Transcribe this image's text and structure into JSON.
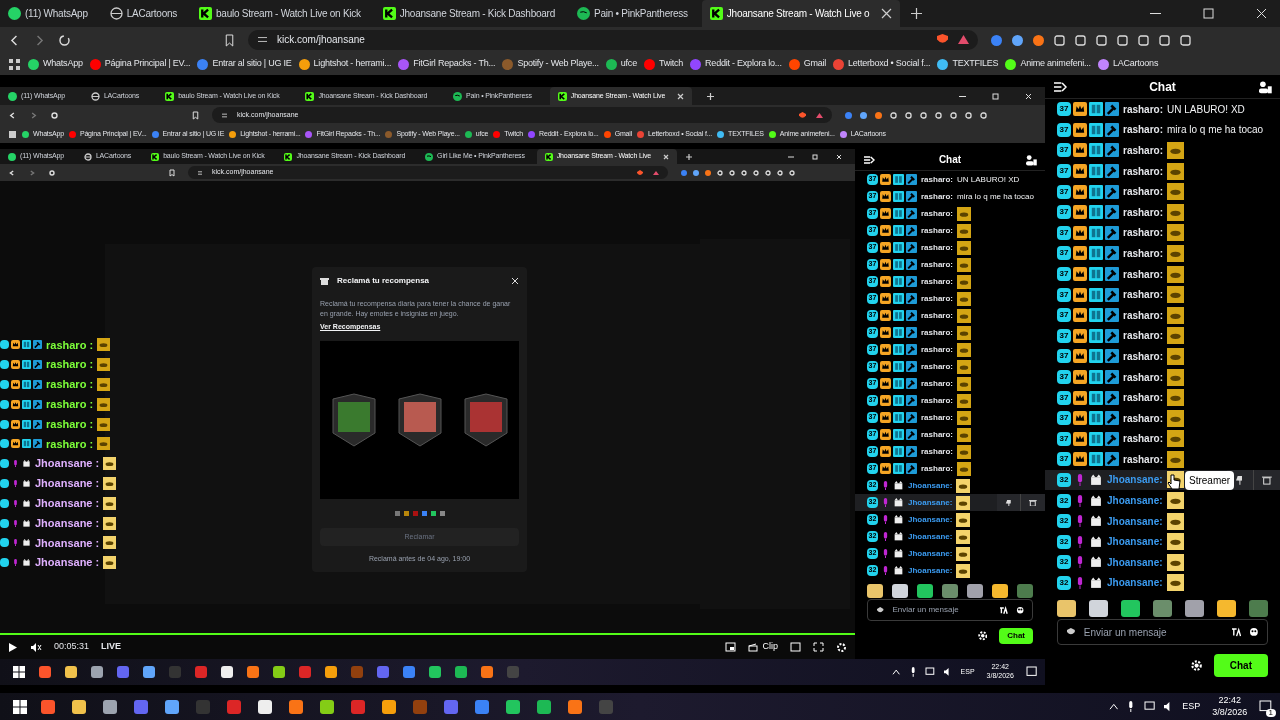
{
  "browser": {
    "tabs": [
      {
        "title": "(11) WhatsApp",
        "kind": "whatsapp",
        "selected": false
      },
      {
        "title": "LACartoons",
        "kind": "globe",
        "selected": false
      },
      {
        "title": "baulo Stream - Watch Live on Kick",
        "kind": "kick",
        "selected": false
      },
      {
        "title": "Jhoansane Stream - Kick Dashboard",
        "kind": "kick",
        "selected": false
      },
      {
        "title": "Pain • PinkPantheress",
        "kind": "spotify",
        "selected": false
      },
      {
        "title": "Jhoansane Stream - Watch Live o",
        "kind": "kick",
        "selected": true
      }
    ],
    "address": "kick.com/jhoansane",
    "bookmarks": [
      "WhatsApp",
      "Página Principal | EV...",
      "Entrar al sitio | UG IE",
      "Lightshot - herrami...",
      "FitGirl Repacks - Th...",
      "Spotify - Web Playe...",
      "ufce",
      "Twitch",
      "Reddit - Explora lo...",
      "Gmail",
      "Letterboxd • Social f...",
      "TEXTFILES",
      "Anime animefeni...",
      "LACartoons"
    ]
  },
  "stream": {
    "browser": {
      "tabs": [
        {
          "title": "(11) WhatsApp",
          "kind": "whatsapp",
          "selected": false
        },
        {
          "title": "LACartoons",
          "kind": "globe",
          "selected": false
        },
        {
          "title": "baulo Stream - Watch Live on Kick",
          "kind": "kick",
          "selected": false
        },
        {
          "title": "Jhoansane Stream - Kick Dashboard",
          "kind": "kick",
          "selected": false
        },
        {
          "title": "Pain • PinkPantheress",
          "kind": "spotify",
          "selected": false
        },
        {
          "title": "Jhoansane Stream - Watch Live",
          "kind": "kick",
          "selected": true
        }
      ],
      "address": "kick.com/jhoansane",
      "bookmarks": [
        "WhatsApp",
        "Página Principal | EV...",
        "Entrar al sitio | UG IE",
        "Lightshot - herrami...",
        "FitGirl Repacks - Th...",
        "Spotify - Web Playe...",
        "ufce",
        "Twitch",
        "Reddit - Explora lo...",
        "Gmail",
        "Letterboxd • Social f...",
        "TEXTFILES",
        "Anime animefeni...",
        "LACartoons"
      ]
    },
    "capture": {
      "tabs": [
        {
          "title": "(11) WhatsApp",
          "kind": "whatsapp",
          "selected": false
        },
        {
          "title": "LACartoons",
          "kind": "globe",
          "selected": false
        },
        {
          "title": "baulo Stream - Watch Live on Kick",
          "kind": "kick",
          "selected": false
        },
        {
          "title": "Jhoansane Stream - Kick Dashboard",
          "kind": "kick",
          "selected": false
        },
        {
          "title": "Girl Like Me • PinkPantheress",
          "kind": "spotify",
          "selected": false
        },
        {
          "title": "Jhoansane Stream - Watch Live",
          "kind": "kick",
          "selected": true
        }
      ],
      "address": "kick.com/jhoansane",
      "popup": {
        "title": "Reclamá tu recompensa",
        "body": "Reclamá tu recompensa diaria para tener la chance de ganar en grande. Hay emotes e insignias en juego.",
        "link": "Ver Recompensas",
        "button": "Reclamar",
        "deadline": "Reclamá antes de 04 ago, 19:00"
      },
      "overlay_chat": [
        {
          "user": "rasharo :",
          "kind": "viewer"
        },
        {
          "user": "rasharo :",
          "kind": "viewer"
        },
        {
          "user": "rasharo :",
          "kind": "viewer"
        },
        {
          "user": "rasharo :",
          "kind": "viewer"
        },
        {
          "user": "rasharo :",
          "kind": "viewer"
        },
        {
          "user": "rasharo :",
          "kind": "viewer"
        },
        {
          "user": "Jhoansane :",
          "kind": "broadcaster"
        },
        {
          "user": "Jhoansane :",
          "kind": "broadcaster"
        },
        {
          "user": "Jhoansane :",
          "kind": "broadcaster"
        },
        {
          "user": "Jhoansane :",
          "kind": "broadcaster"
        },
        {
          "user": "Jhoansane :",
          "kind": "broadcaster"
        },
        {
          "user": "Jhoansane :",
          "kind": "broadcaster"
        }
      ]
    },
    "chat": {
      "title": "Chat",
      "messages": [
        {
          "kind": "viewer",
          "level_badge": "37",
          "user": "rasharo:",
          "text": "UN LABURO! XD",
          "emote": false,
          "hovered": false
        },
        {
          "kind": "viewer",
          "level_badge": "37",
          "user": "rasharo:",
          "text": "mira lo q me ha tocao",
          "emote": false,
          "hovered": false
        },
        {
          "kind": "viewer",
          "level_badge": "37",
          "user": "rasharo:",
          "emote": true,
          "hovered": false
        },
        {
          "kind": "viewer",
          "level_badge": "37",
          "user": "rasharo:",
          "emote": true,
          "hovered": false
        },
        {
          "kind": "viewer",
          "level_badge": "37",
          "user": "rasharo:",
          "emote": true,
          "hovered": false
        },
        {
          "kind": "viewer",
          "level_badge": "37",
          "user": "rasharo:",
          "emote": true,
          "hovered": false
        },
        {
          "kind": "viewer",
          "level_badge": "37",
          "user": "rasharo:",
          "emote": true,
          "hovered": false
        },
        {
          "kind": "viewer",
          "level_badge": "37",
          "user": "rasharo:",
          "emote": true,
          "hovered": false
        },
        {
          "kind": "viewer",
          "level_badge": "37",
          "user": "rasharo:",
          "emote": true,
          "hovered": false
        },
        {
          "kind": "viewer",
          "level_badge": "37",
          "user": "rasharo:",
          "emote": true,
          "hovered": false
        },
        {
          "kind": "viewer",
          "level_badge": "37",
          "user": "rasharo:",
          "emote": true,
          "hovered": false
        },
        {
          "kind": "viewer",
          "level_badge": "37",
          "user": "rasharo:",
          "emote": true,
          "hovered": false
        },
        {
          "kind": "viewer",
          "level_badge": "37",
          "user": "rasharo:",
          "emote": true,
          "hovered": false
        },
        {
          "kind": "viewer",
          "level_badge": "37",
          "user": "rasharo:",
          "emote": true,
          "hovered": false
        },
        {
          "kind": "viewer",
          "level_badge": "37",
          "user": "rasharo:",
          "emote": true,
          "hovered": false
        },
        {
          "kind": "viewer",
          "level_badge": "37",
          "user": "rasharo:",
          "emote": true,
          "hovered": false
        },
        {
          "kind": "viewer",
          "level_badge": "37",
          "user": "rasharo:",
          "emote": true,
          "hovered": false
        },
        {
          "kind": "viewer",
          "level_badge": "37",
          "user": "rasharo:",
          "emote": true,
          "hovered": false
        },
        {
          "kind": "broadcaster",
          "level_badge": "32",
          "user": "Jhoansane:",
          "emote": true,
          "hovered": false
        },
        {
          "kind": "broadcaster",
          "level_badge": "32",
          "user": "Jhoansane:",
          "emote": true,
          "hovered": true
        },
        {
          "kind": "broadcaster",
          "level_badge": "32",
          "user": "Jhoansane:",
          "emote": true,
          "hovered": false
        },
        {
          "kind": "broadcaster",
          "level_badge": "32",
          "user": "Jhoansane:",
          "emote": true,
          "hovered": false
        },
        {
          "kind": "broadcaster",
          "level_badge": "32",
          "user": "Jhoansane:",
          "emote": true,
          "hovered": false
        },
        {
          "kind": "broadcaster",
          "level_badge": "32",
          "user": "Jhoansane:",
          "emote": true,
          "hovered": false
        }
      ],
      "placeholder": "Enviar un mensaje",
      "send": "Chat"
    },
    "player": {
      "time": "00:05:31",
      "live": "LIVE",
      "clip": "Clip"
    },
    "taskbar": {
      "language": "ESP",
      "time": "22:42",
      "date": "3/8/2026"
    }
  },
  "chat": {
    "title": "Chat",
    "messages": [
      {
        "kind": "viewer",
        "level_badge": "37",
        "user": "rasharo:",
        "text": "UN LABURO! XD",
        "emote": false,
        "hovered": false
      },
      {
        "kind": "viewer",
        "level_badge": "37",
        "user": "rasharo:",
        "text": "mira lo q me ha tocao",
        "emote": false,
        "hovered": false
      },
      {
        "kind": "viewer",
        "level_badge": "37",
        "user": "rasharo:",
        "emote": true,
        "hovered": false
      },
      {
        "kind": "viewer",
        "level_badge": "37",
        "user": "rasharo:",
        "emote": true,
        "hovered": false
      },
      {
        "kind": "viewer",
        "level_badge": "37",
        "user": "rasharo:",
        "emote": true,
        "hovered": false
      },
      {
        "kind": "viewer",
        "level_badge": "37",
        "user": "rasharo:",
        "emote": true,
        "hovered": false
      },
      {
        "kind": "viewer",
        "level_badge": "37",
        "user": "rasharo:",
        "emote": true,
        "hovered": false
      },
      {
        "kind": "viewer",
        "level_badge": "37",
        "user": "rasharo:",
        "emote": true,
        "hovered": false
      },
      {
        "kind": "viewer",
        "level_badge": "37",
        "user": "rasharo:",
        "emote": true,
        "hovered": false
      },
      {
        "kind": "viewer",
        "level_badge": "37",
        "user": "rasharo:",
        "emote": true,
        "hovered": false
      },
      {
        "kind": "viewer",
        "level_badge": "37",
        "user": "rasharo:",
        "emote": true,
        "hovered": false
      },
      {
        "kind": "viewer",
        "level_badge": "37",
        "user": "rasharo:",
        "emote": true,
        "hovered": false
      },
      {
        "kind": "viewer",
        "level_badge": "37",
        "user": "rasharo:",
        "emote": true,
        "hovered": false
      },
      {
        "kind": "viewer",
        "level_badge": "37",
        "user": "rasharo:",
        "emote": true,
        "hovered": false
      },
      {
        "kind": "viewer",
        "level_badge": "37",
        "user": "rasharo:",
        "emote": true,
        "hovered": false
      },
      {
        "kind": "viewer",
        "level_badge": "37",
        "user": "rasharo:",
        "emote": true,
        "hovered": false
      },
      {
        "kind": "viewer",
        "level_badge": "37",
        "user": "rasharo:",
        "emote": true,
        "hovered": false
      },
      {
        "kind": "viewer",
        "level_badge": "37",
        "user": "rasharo:",
        "emote": true,
        "hovered": false
      },
      {
        "kind": "broadcaster",
        "level_badge": "32",
        "user": "Jhoansane:",
        "emote": true,
        "hovered": true,
        "tooltip": "Streamer"
      },
      {
        "kind": "broadcaster",
        "level_badge": "32",
        "user": "Jhoansane:",
        "emote": true,
        "hovered": false
      },
      {
        "kind": "broadcaster",
        "level_badge": "32",
        "user": "Jhoansane:",
        "emote": true,
        "hovered": false
      },
      {
        "kind": "broadcaster",
        "level_badge": "32",
        "user": "Jhoansane:",
        "emote": true,
        "hovered": false
      },
      {
        "kind": "broadcaster",
        "level_badge": "32",
        "user": "Jhoansane:",
        "emote": true,
        "hovered": false
      },
      {
        "kind": "broadcaster",
        "level_badge": "32",
        "user": "Jhoansane:",
        "emote": true,
        "hovered": false
      }
    ],
    "placeholder": "Enviar un mensaje",
    "send": "Chat"
  },
  "taskbar": {
    "language": "ESP",
    "time": "22:42",
    "date": "3/8/2026",
    "notifications": "1"
  }
}
